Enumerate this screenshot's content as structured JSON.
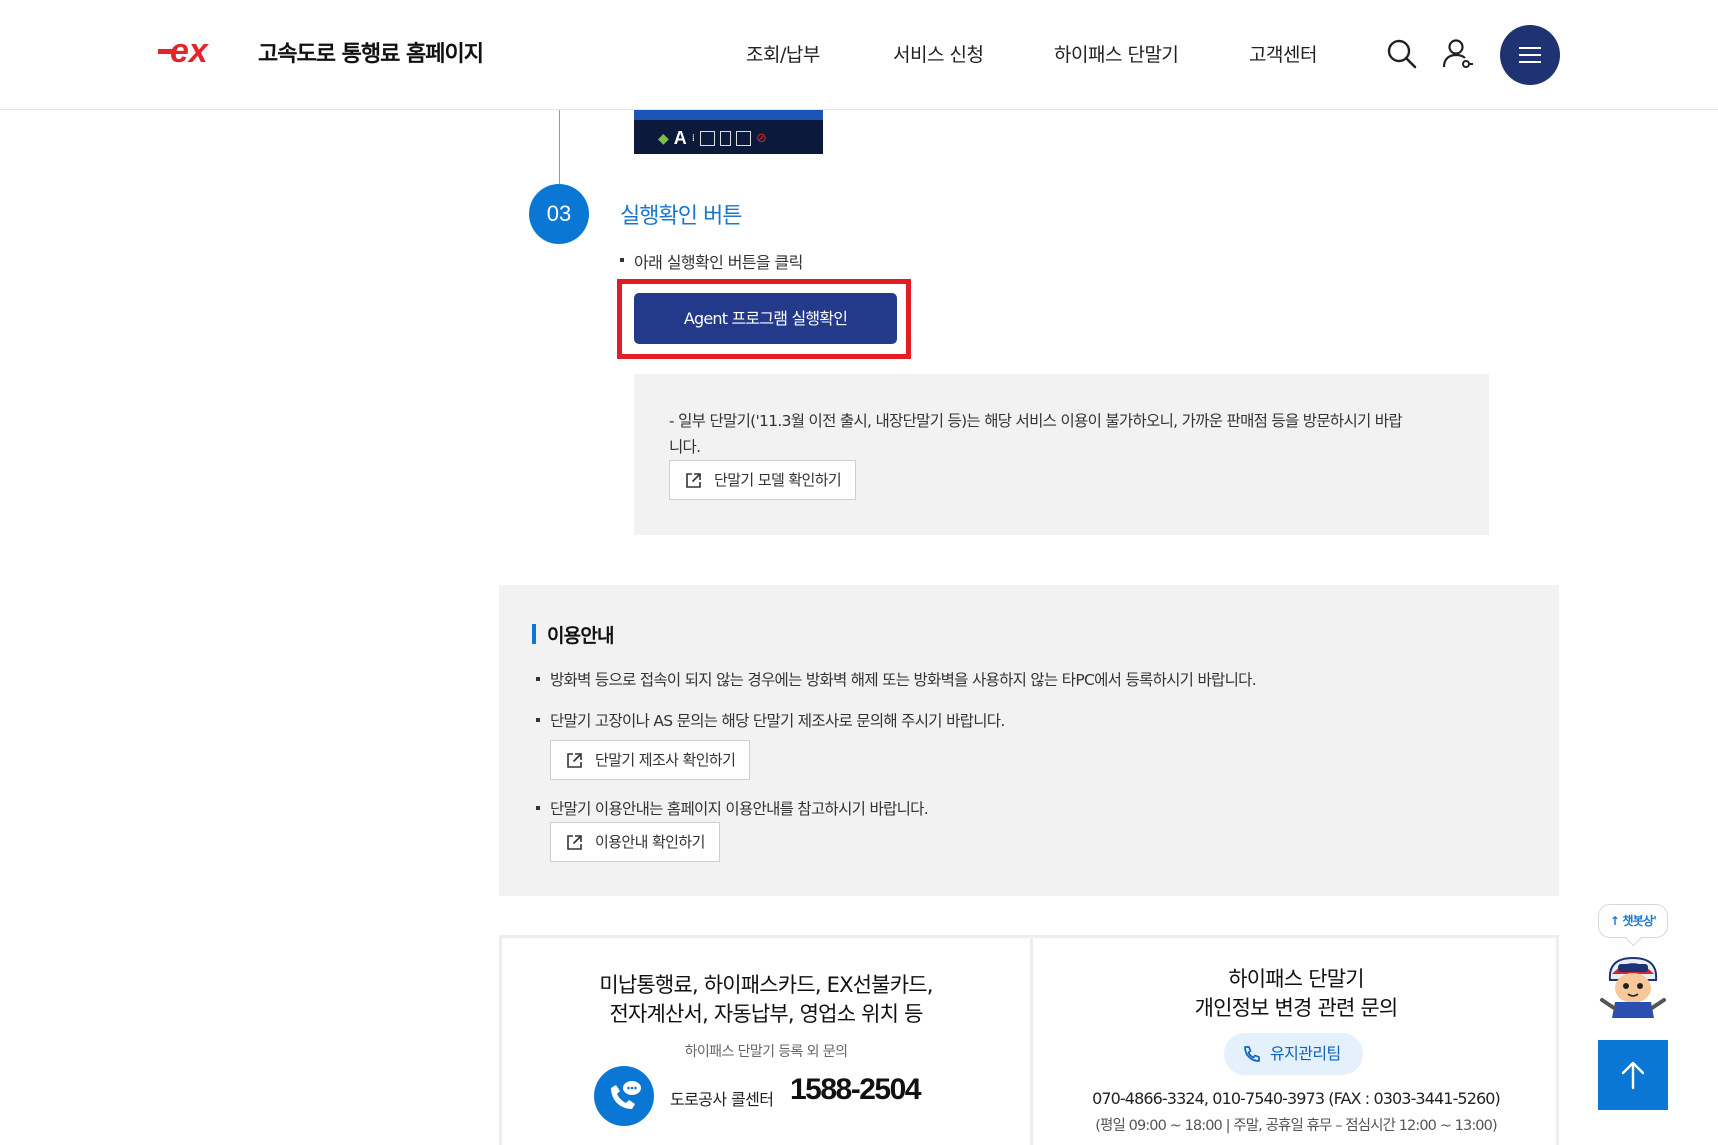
{
  "header": {
    "logo_mark": "ex",
    "site_title": "고속도로 통행료 홈페이지",
    "nav": [
      "조회/납부",
      "서비스 신청",
      "하이패스 단말기",
      "고객센터"
    ],
    "icons": [
      "search-icon",
      "user-icon",
      "menu-icon"
    ]
  },
  "step3": {
    "number": "03",
    "title": "실행확인 버튼",
    "description": "아래 실행확인 버튼을 클릭",
    "button_label": "Agent 프로그램 실행확인",
    "notice": "- 일부 단말기('11.3월 이전 출시, 내장단말기 등)는 해당 서비스 이용이 불가하오니, 가까운 판매점 등을 방문하시기 바랍니다.",
    "notice_link": "단말기 모델 확인하기",
    "taskbar_letter": "A"
  },
  "guide": {
    "title": "이용안내",
    "items": [
      "방화벽 등으로 접속이 되지 않는 경우에는 방화벽 해제 또는 방화벽을 사용하지 않는 타PC에서 등록하시기 바랍니다.",
      "단말기 고장이나 AS 문의는 해당 단말기 제조사로 문의해 주시기 바랍니다.",
      "단말기 이용안내는 홈페이지 이용안내를 참고하시기 바랍니다."
    ],
    "link_manufacturer": "단말기 제조사 확인하기",
    "link_usage": "이용안내 확인하기"
  },
  "contact": {
    "left": {
      "title_line1": "미납통행료, 하이패스카드, EX선불카드,",
      "title_line2": "전자계산서, 자동납부, 영업소 위치 등",
      "subtitle": "하이패스 단말기 등록 외 문의",
      "label": "도로공사 콜센터",
      "number": "1588-2504"
    },
    "right": {
      "title_line1": "하이패스 단말기",
      "title_line2": "개인정보 변경 관련 문의",
      "team": "유지관리팀",
      "phones": "070-4866-3324, 010-7540-3973 (FAX : 0303-3441-5260)",
      "hours": "(평일 09:00 ~ 18:00 | 주말, 공휴일 휴무 – 점심시간 12:00 ~ 13:00)"
    }
  },
  "floating": {
    "chatbot_label": "↑ 챗봇상'",
    "top_icon": "arrow-up-icon"
  },
  "colors": {
    "brand_navy": "#1f3372",
    "accent_blue": "#0b77d5",
    "button_navy": "#233a8a",
    "highlight_red": "#e21d25",
    "logo_red": "#e3262b"
  }
}
